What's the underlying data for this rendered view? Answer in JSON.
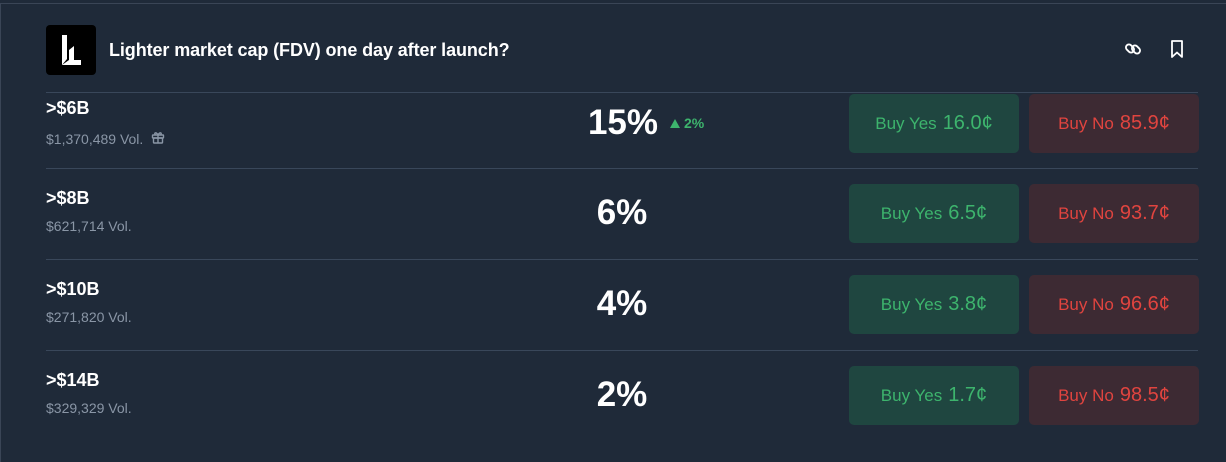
{
  "market": {
    "title": "Lighter market cap (FDV) one day after launch?"
  },
  "header": {
    "icons": [
      "link-icon",
      "bookmark-icon"
    ]
  },
  "colors": {
    "background": "#1f2a39",
    "yes": "#3db46d",
    "no": "#e0443f",
    "yes_bg": "#1f4640",
    "no_bg": "#3d2a33"
  },
  "outcomes": [
    {
      "label": ">$6B",
      "volume": "$1,370,489 Vol.",
      "has_gift_icon": true,
      "percent": "15%",
      "change": "2%",
      "change_direction": "up",
      "buy_yes_label": "Buy Yes",
      "buy_yes_price": "16.0¢",
      "buy_no_label": "Buy No",
      "buy_no_price": "85.9¢"
    },
    {
      "label": ">$8B",
      "volume": "$621,714 Vol.",
      "percent": "6%",
      "buy_yes_label": "Buy Yes",
      "buy_yes_price": "6.5¢",
      "buy_no_label": "Buy No",
      "buy_no_price": "93.7¢"
    },
    {
      "label": ">$10B",
      "volume": "$271,820 Vol.",
      "percent": "4%",
      "buy_yes_label": "Buy Yes",
      "buy_yes_price": "3.8¢",
      "buy_no_label": "Buy No",
      "buy_no_price": "96.6¢"
    },
    {
      "label": ">$14B",
      "volume": "$329,329 Vol.",
      "percent": "2%",
      "buy_yes_label": "Buy Yes",
      "buy_yes_price": "1.7¢",
      "buy_no_label": "Buy No",
      "buy_no_price": "98.5¢"
    }
  ]
}
